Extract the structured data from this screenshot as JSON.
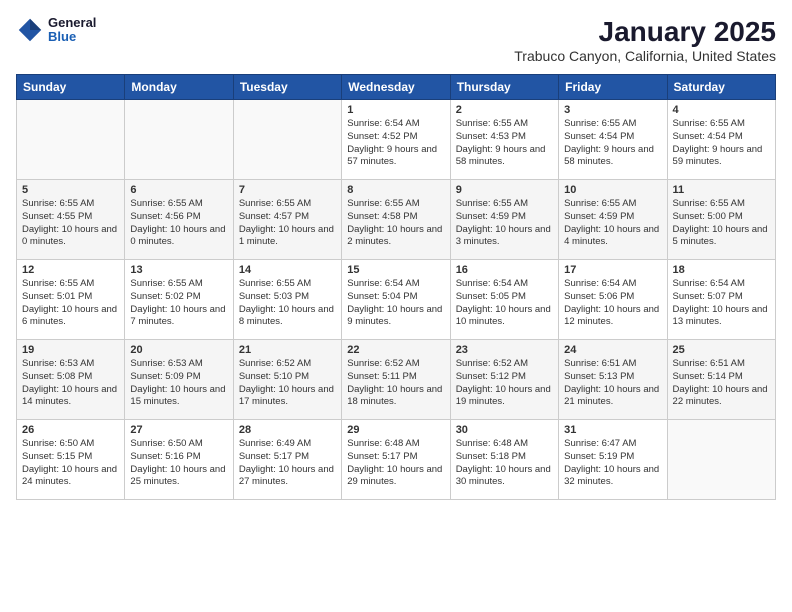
{
  "header": {
    "logo_general": "General",
    "logo_blue": "Blue",
    "title": "January 2025",
    "subtitle": "Trabuco Canyon, California, United States"
  },
  "weekdays": [
    "Sunday",
    "Monday",
    "Tuesday",
    "Wednesday",
    "Thursday",
    "Friday",
    "Saturday"
  ],
  "weeks": [
    [
      {
        "day": null
      },
      {
        "day": null
      },
      {
        "day": null
      },
      {
        "day": "1",
        "sunrise": "Sunrise: 6:54 AM",
        "sunset": "Sunset: 4:52 PM",
        "daylight": "Daylight: 9 hours and 57 minutes."
      },
      {
        "day": "2",
        "sunrise": "Sunrise: 6:55 AM",
        "sunset": "Sunset: 4:53 PM",
        "daylight": "Daylight: 9 hours and 58 minutes."
      },
      {
        "day": "3",
        "sunrise": "Sunrise: 6:55 AM",
        "sunset": "Sunset: 4:54 PM",
        "daylight": "Daylight: 9 hours and 58 minutes."
      },
      {
        "day": "4",
        "sunrise": "Sunrise: 6:55 AM",
        "sunset": "Sunset: 4:54 PM",
        "daylight": "Daylight: 9 hours and 59 minutes."
      }
    ],
    [
      {
        "day": "5",
        "sunrise": "Sunrise: 6:55 AM",
        "sunset": "Sunset: 4:55 PM",
        "daylight": "Daylight: 10 hours and 0 minutes."
      },
      {
        "day": "6",
        "sunrise": "Sunrise: 6:55 AM",
        "sunset": "Sunset: 4:56 PM",
        "daylight": "Daylight: 10 hours and 0 minutes."
      },
      {
        "day": "7",
        "sunrise": "Sunrise: 6:55 AM",
        "sunset": "Sunset: 4:57 PM",
        "daylight": "Daylight: 10 hours and 1 minute."
      },
      {
        "day": "8",
        "sunrise": "Sunrise: 6:55 AM",
        "sunset": "Sunset: 4:58 PM",
        "daylight": "Daylight: 10 hours and 2 minutes."
      },
      {
        "day": "9",
        "sunrise": "Sunrise: 6:55 AM",
        "sunset": "Sunset: 4:59 PM",
        "daylight": "Daylight: 10 hours and 3 minutes."
      },
      {
        "day": "10",
        "sunrise": "Sunrise: 6:55 AM",
        "sunset": "Sunset: 4:59 PM",
        "daylight": "Daylight: 10 hours and 4 minutes."
      },
      {
        "day": "11",
        "sunrise": "Sunrise: 6:55 AM",
        "sunset": "Sunset: 5:00 PM",
        "daylight": "Daylight: 10 hours and 5 minutes."
      }
    ],
    [
      {
        "day": "12",
        "sunrise": "Sunrise: 6:55 AM",
        "sunset": "Sunset: 5:01 PM",
        "daylight": "Daylight: 10 hours and 6 minutes."
      },
      {
        "day": "13",
        "sunrise": "Sunrise: 6:55 AM",
        "sunset": "Sunset: 5:02 PM",
        "daylight": "Daylight: 10 hours and 7 minutes."
      },
      {
        "day": "14",
        "sunrise": "Sunrise: 6:55 AM",
        "sunset": "Sunset: 5:03 PM",
        "daylight": "Daylight: 10 hours and 8 minutes."
      },
      {
        "day": "15",
        "sunrise": "Sunrise: 6:54 AM",
        "sunset": "Sunset: 5:04 PM",
        "daylight": "Daylight: 10 hours and 9 minutes."
      },
      {
        "day": "16",
        "sunrise": "Sunrise: 6:54 AM",
        "sunset": "Sunset: 5:05 PM",
        "daylight": "Daylight: 10 hours and 10 minutes."
      },
      {
        "day": "17",
        "sunrise": "Sunrise: 6:54 AM",
        "sunset": "Sunset: 5:06 PM",
        "daylight": "Daylight: 10 hours and 12 minutes."
      },
      {
        "day": "18",
        "sunrise": "Sunrise: 6:54 AM",
        "sunset": "Sunset: 5:07 PM",
        "daylight": "Daylight: 10 hours and 13 minutes."
      }
    ],
    [
      {
        "day": "19",
        "sunrise": "Sunrise: 6:53 AM",
        "sunset": "Sunset: 5:08 PM",
        "daylight": "Daylight: 10 hours and 14 minutes."
      },
      {
        "day": "20",
        "sunrise": "Sunrise: 6:53 AM",
        "sunset": "Sunset: 5:09 PM",
        "daylight": "Daylight: 10 hours and 15 minutes."
      },
      {
        "day": "21",
        "sunrise": "Sunrise: 6:52 AM",
        "sunset": "Sunset: 5:10 PM",
        "daylight": "Daylight: 10 hours and 17 minutes."
      },
      {
        "day": "22",
        "sunrise": "Sunrise: 6:52 AM",
        "sunset": "Sunset: 5:11 PM",
        "daylight": "Daylight: 10 hours and 18 minutes."
      },
      {
        "day": "23",
        "sunrise": "Sunrise: 6:52 AM",
        "sunset": "Sunset: 5:12 PM",
        "daylight": "Daylight: 10 hours and 19 minutes."
      },
      {
        "day": "24",
        "sunrise": "Sunrise: 6:51 AM",
        "sunset": "Sunset: 5:13 PM",
        "daylight": "Daylight: 10 hours and 21 minutes."
      },
      {
        "day": "25",
        "sunrise": "Sunrise: 6:51 AM",
        "sunset": "Sunset: 5:14 PM",
        "daylight": "Daylight: 10 hours and 22 minutes."
      }
    ],
    [
      {
        "day": "26",
        "sunrise": "Sunrise: 6:50 AM",
        "sunset": "Sunset: 5:15 PM",
        "daylight": "Daylight: 10 hours and 24 minutes."
      },
      {
        "day": "27",
        "sunrise": "Sunrise: 6:50 AM",
        "sunset": "Sunset: 5:16 PM",
        "daylight": "Daylight: 10 hours and 25 minutes."
      },
      {
        "day": "28",
        "sunrise": "Sunrise: 6:49 AM",
        "sunset": "Sunset: 5:17 PM",
        "daylight": "Daylight: 10 hours and 27 minutes."
      },
      {
        "day": "29",
        "sunrise": "Sunrise: 6:48 AM",
        "sunset": "Sunset: 5:17 PM",
        "daylight": "Daylight: 10 hours and 29 minutes."
      },
      {
        "day": "30",
        "sunrise": "Sunrise: 6:48 AM",
        "sunset": "Sunset: 5:18 PM",
        "daylight": "Daylight: 10 hours and 30 minutes."
      },
      {
        "day": "31",
        "sunrise": "Sunrise: 6:47 AM",
        "sunset": "Sunset: 5:19 PM",
        "daylight": "Daylight: 10 hours and 32 minutes."
      },
      {
        "day": null
      }
    ]
  ]
}
